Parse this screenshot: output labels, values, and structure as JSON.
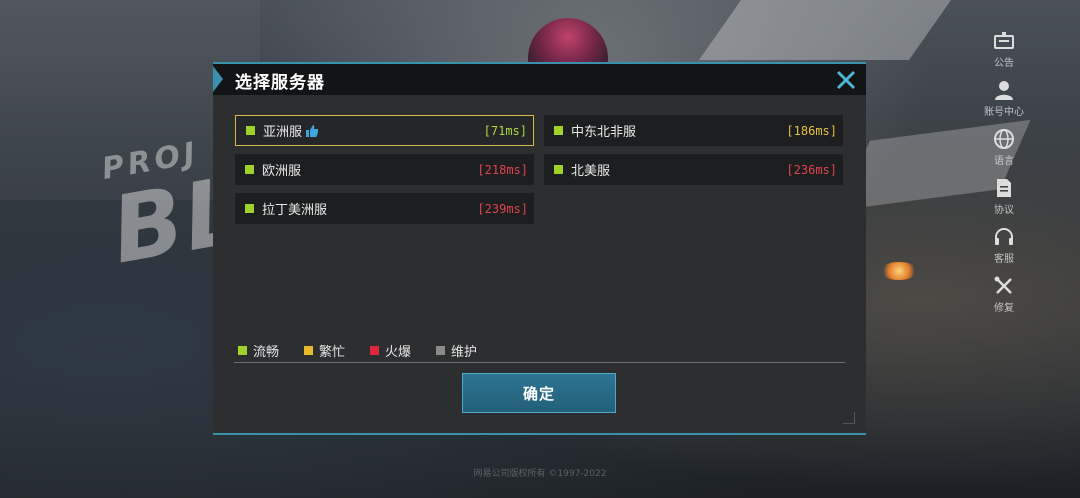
{
  "background": {
    "logo_line1": "PROJ",
    "logo_line2": "BL",
    "copyright": "网易公司版权所有 ©1997-2022"
  },
  "side_menu": [
    {
      "label": "公告",
      "icon": "announcement-icon"
    },
    {
      "label": "账号中心",
      "icon": "account-icon"
    },
    {
      "label": "语言",
      "icon": "globe-icon"
    },
    {
      "label": "协议",
      "icon": "document-icon"
    },
    {
      "label": "客服",
      "icon": "headset-icon"
    },
    {
      "label": "修复",
      "icon": "repair-icon"
    }
  ],
  "dialog": {
    "title": "选择服务器",
    "confirm_label": "确定"
  },
  "servers": [
    {
      "name": "亚洲服",
      "ping": "[71ms]",
      "ping_color": "#a8d93a",
      "status": "流畅",
      "recommended": true,
      "selected": true
    },
    {
      "name": "中东北非服",
      "ping": "[186ms]",
      "ping_color": "#e3c23a",
      "status": "流畅",
      "recommended": false,
      "selected": false
    },
    {
      "name": "欧洲服",
      "ping": "[218ms]",
      "ping_color": "#e2434b",
      "status": "流畅",
      "recommended": false,
      "selected": false
    },
    {
      "name": "北美服",
      "ping": "[236ms]",
      "ping_color": "#e2434b",
      "status": "流畅",
      "recommended": false,
      "selected": false
    },
    {
      "name": "拉丁美洲服",
      "ping": "[239ms]",
      "ping_color": "#e2434b",
      "status": "流畅",
      "recommended": false,
      "selected": false
    }
  ],
  "legend": [
    {
      "label": "流畅",
      "color": "#9fd32a"
    },
    {
      "label": "繁忙",
      "color": "#e8b92c"
    },
    {
      "label": "火爆",
      "color": "#e0283c"
    },
    {
      "label": "维护",
      "color": "#8a8a8a"
    }
  ],
  "colors": {
    "accent": "#3b90ad",
    "selected_border": "#d9b845"
  }
}
